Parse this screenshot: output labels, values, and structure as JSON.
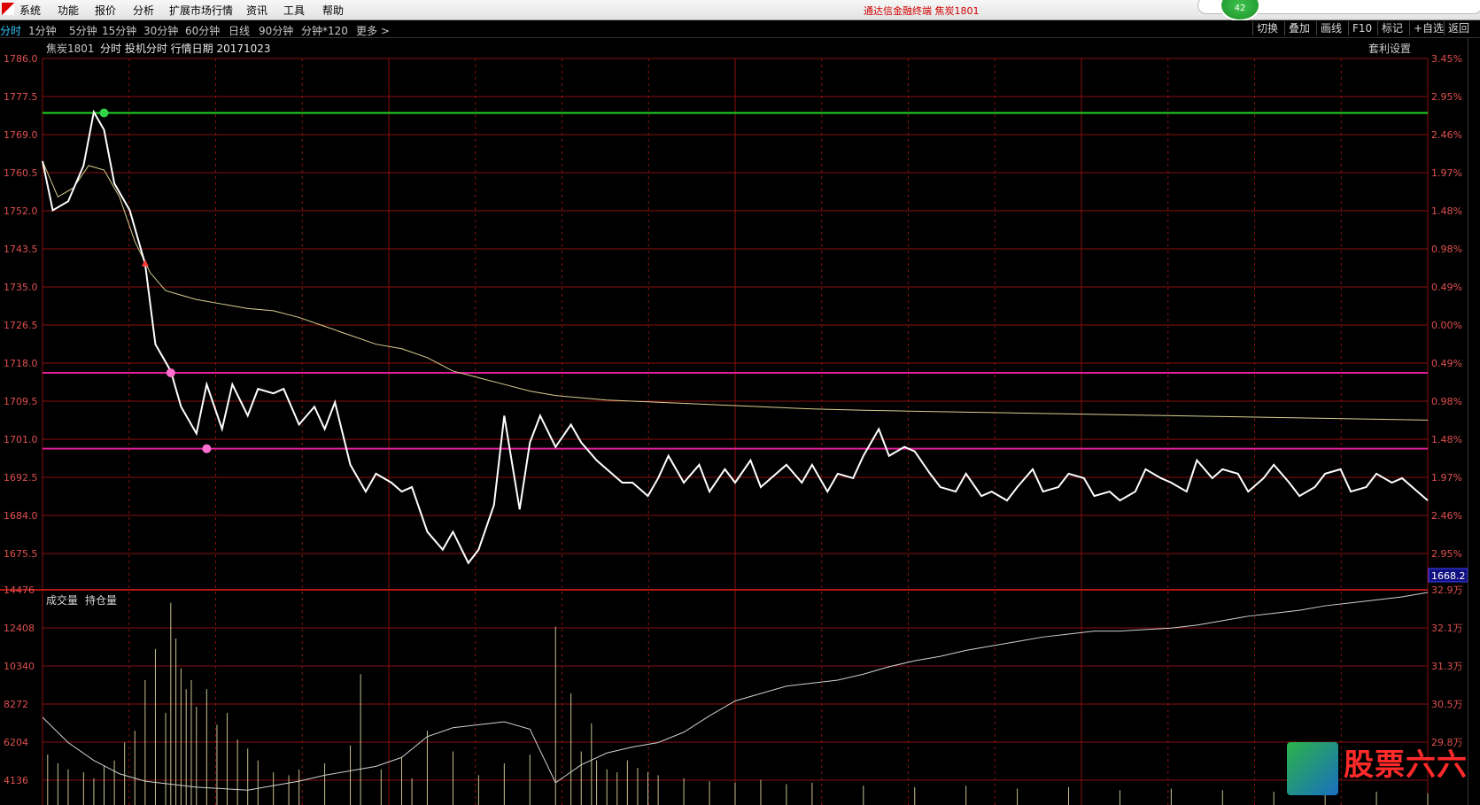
{
  "menubar": {
    "items": [
      "系统",
      "功能",
      "报价",
      "分析",
      "扩展市场行情",
      "资讯",
      "工具",
      "帮助"
    ],
    "app_title": "通达信金融终端   焦炭1801",
    "badge": "42"
  },
  "periodbar": {
    "items": [
      "分时",
      "1分钟",
      "5分钟",
      "15分钟",
      "30分钟",
      "60分钟",
      "日线",
      "90分钟",
      "分钟*120",
      "更多 >"
    ],
    "tools": [
      "切换",
      "叠加",
      "画线",
      "F10",
      "标记",
      "+自选",
      "返回"
    ]
  },
  "infobar": {
    "symbol": "焦炭1801",
    "text": "分时 投机分时 行情日期 20171023",
    "right_label": "套利设置"
  },
  "colors": {
    "price_line": "#ffffff",
    "avg_line": "#d8d090",
    "grid": "#8a1010",
    "green_line": "#22d822",
    "magenta_line": "#e0209a",
    "left_axis_text": "#e05050",
    "right_axis_text": "#e05050",
    "volume_bar": "#c8c090",
    "oi_line": "#d0d0d0"
  },
  "chart_data": {
    "type": "line",
    "price_axis": {
      "ticks": [
        "1786.0",
        "1777.5",
        "1769.0",
        "1760.5",
        "1752.0",
        "1743.5",
        "1735.0",
        "1726.5",
        "1718.0",
        "1709.5",
        "1701.0",
        "1692.5",
        "1684.0",
        "1675.5"
      ],
      "ylim": [
        1667.0,
        1786.0
      ],
      "current_price_label": "1668.2"
    },
    "pct_axis": {
      "ticks": [
        "3.45%",
        "2.95%",
        "2.46%",
        "1.97%",
        "1.48%",
        "0.98%",
        "0.49%",
        "0.00%",
        "0.49%",
        "0.98%",
        "1.48%",
        "1.97%",
        "2.46%",
        "2.95%"
      ]
    },
    "hlines": [
      {
        "value": 1773.8,
        "color": "green"
      },
      {
        "value": 1715.6,
        "color": "magenta"
      },
      {
        "value": 1698.6,
        "color": "magenta"
      }
    ],
    "price_series": {
      "name": "",
      "x": [
        0,
        2,
        5,
        8,
        10,
        12,
        14,
        17,
        20,
        22,
        25,
        27,
        30,
        32,
        35,
        37,
        40,
        42,
        45,
        47,
        50,
        53,
        55,
        57,
        60,
        63,
        65,
        68,
        70,
        72,
        75,
        78,
        80,
        83,
        85,
        88,
        90,
        93,
        95,
        97,
        100,
        103,
        105,
        108,
        110,
        113,
        115,
        118,
        120,
        122,
        125,
        128,
        130,
        133,
        135,
        138,
        140,
        143,
        145,
        148,
        150,
        153,
        155,
        158,
        160,
        163,
        165,
        168,
        170,
        173,
        175,
        178,
        180,
        183,
        185,
        188,
        190,
        193,
        195,
        198,
        200,
        203,
        205,
        208,
        210,
        213,
        215,
        218,
        220,
        223,
        225,
        228,
        230,
        233,
        235,
        238,
        240,
        243,
        245,
        248,
        250,
        253,
        255,
        258,
        260,
        263,
        265,
        268,
        270
      ],
      "y": [
        1763,
        1752,
        1754,
        1762,
        1774,
        1770,
        1758,
        1752,
        1740,
        1722,
        1716,
        1708,
        1702,
        1713,
        1703,
        1713,
        1706,
        1712,
        1711,
        1712,
        1704,
        1708,
        1703,
        1709,
        1695,
        1689,
        1693,
        1691,
        1689,
        1690,
        1680,
        1676,
        1680,
        1673,
        1676,
        1686,
        1706,
        1685,
        1700,
        1706,
        1699,
        1704,
        1700,
        1696,
        1694,
        1691,
        1691,
        1688,
        1692,
        1697,
        1691,
        1695,
        1689,
        1694,
        1691,
        1696,
        1690,
        1693,
        1695,
        1691,
        1695,
        1689,
        1693,
        1692,
        1697,
        1703,
        1697,
        1699,
        1698,
        1693,
        1690,
        1689,
        1693,
        1688,
        1689,
        1687,
        1690,
        1694,
        1689,
        1690,
        1693,
        1692,
        1688,
        1689,
        1687,
        1689,
        1694,
        1692,
        1691,
        1689,
        1696,
        1692,
        1694,
        1693,
        1689,
        1692,
        1695,
        1691,
        1688,
        1690,
        1693,
        1694,
        1689,
        1690,
        1693,
        1691,
        1692,
        1689,
        1687
      ],
      "extra_segments": [
        {
          "x": [
            30,
            34,
            37,
            42,
            48,
            55,
            60,
            65,
            72,
            78,
            85,
            90,
            95,
            100,
            105,
            110,
            115,
            120,
            125,
            130,
            135,
            140,
            145,
            150,
            155,
            160,
            165,
            170,
            175,
            180,
            185,
            190,
            195,
            200,
            205,
            210,
            215,
            220,
            225,
            230,
            235,
            240,
            245,
            250,
            255,
            260,
            265,
            270
          ],
          "y": [
            0
          ]
        }
      ]
    },
    "avg_series": {
      "name": "",
      "x": [
        0,
        3,
        6,
        9,
        12,
        15,
        18,
        21,
        24,
        27,
        30,
        35,
        40,
        45,
        50,
        55,
        60,
        65,
        70,
        75,
        80,
        85,
        90,
        95,
        100,
        110,
        120,
        130,
        140,
        150,
        160,
        170,
        180,
        190,
        200,
        210,
        220,
        230,
        240,
        250,
        260,
        270
      ],
      "y": [
        1763,
        1755,
        1757,
        1762,
        1761,
        1755,
        1745,
        1738,
        1734,
        1733,
        1732,
        1731,
        1730,
        1729.5,
        1728,
        1726,
        1724,
        1722,
        1721,
        1719,
        1716,
        1714.5,
        1713,
        1711.5,
        1710.5,
        1709.5,
        1709,
        1708.5,
        1708,
        1707.5,
        1707.2,
        1707,
        1706.8,
        1706.6,
        1706.4,
        1706.2,
        1706,
        1705.8,
        1705.6,
        1705.4,
        1705.2,
        1705
      ]
    },
    "volume_axis": {
      "ticks": [
        "14476",
        "12408",
        "10340",
        "8272",
        "6204",
        "4136"
      ],
      "ylim": [
        0,
        14476
      ]
    },
    "oi_axis": {
      "ticks": [
        "32.9万",
        "32.1万",
        "31.3万",
        "30.5万",
        "29.8万"
      ]
    },
    "volume_panel_labels": [
      "成交量",
      "持仓量"
    ],
    "volume_series": {
      "name": "",
      "x": [
        1,
        3,
        5,
        8,
        10,
        12,
        14,
        16,
        18,
        20,
        22,
        24,
        25,
        26,
        27,
        28,
        29,
        30,
        32,
        34,
        36,
        38,
        40,
        42,
        45,
        48,
        50,
        55,
        60,
        62,
        66,
        70,
        72,
        75,
        80,
        85,
        90,
        95,
        100,
        103,
        105,
        107,
        108,
        110,
        112,
        114,
        116,
        118,
        120,
        125,
        130,
        135,
        140,
        145,
        150,
        160,
        170,
        180,
        190,
        200,
        210,
        220,
        230,
        240,
        250,
        260,
        270
      ],
      "y": [
        3400,
        2800,
        2400,
        2200,
        1800,
        2600,
        3000,
        4200,
        5000,
        8400,
        10500,
        6200,
        13600,
        11200,
        9200,
        7800,
        8400,
        6600,
        7800,
        5400,
        6200,
        4400,
        3800,
        3000,
        2200,
        2000,
        2400,
        2800,
        4000,
        8800,
        2400,
        3200,
        1800,
        5000,
        3600,
        2000,
        2800,
        3400,
        12000,
        7500,
        3600,
        5500,
        3000,
        2400,
        2200,
        3000,
        2500,
        2200,
        2000,
        1800,
        1600,
        1500,
        1700,
        1400,
        1500,
        1300,
        1200,
        1300,
        1100,
        1200,
        1000,
        1100,
        1000,
        900,
        1000,
        900,
        800
      ]
    },
    "oi_series": {
      "name": "",
      "x": [
        0,
        5,
        10,
        15,
        20,
        25,
        30,
        35,
        40,
        45,
        50,
        55,
        60,
        65,
        70,
        75,
        80,
        85,
        90,
        95,
        100,
        105,
        110,
        115,
        120,
        125,
        130,
        135,
        140,
        145,
        150,
        155,
        160,
        165,
        170,
        175,
        180,
        185,
        190,
        195,
        200,
        205,
        210,
        215,
        220,
        225,
        230,
        235,
        240,
        245,
        250,
        255,
        260,
        265,
        270
      ],
      "y": [
        5900,
        4200,
        3000,
        2100,
        1600,
        1400,
        1200,
        1100,
        1000,
        1300,
        1600,
        2000,
        2300,
        2600,
        3200,
        4600,
        5200,
        5400,
        5600,
        5100,
        1500,
        2700,
        3500,
        3900,
        4200,
        4900,
        6000,
        7000,
        7500,
        8000,
        8200,
        8400,
        8800,
        9300,
        9700,
        10000,
        10400,
        10700,
        11000,
        11300,
        11500,
        11700,
        11700,
        11800,
        11900,
        12100,
        12400,
        12700,
        12900,
        13100,
        13400,
        13600,
        13800,
        14000,
        14300
      ]
    }
  }
}
